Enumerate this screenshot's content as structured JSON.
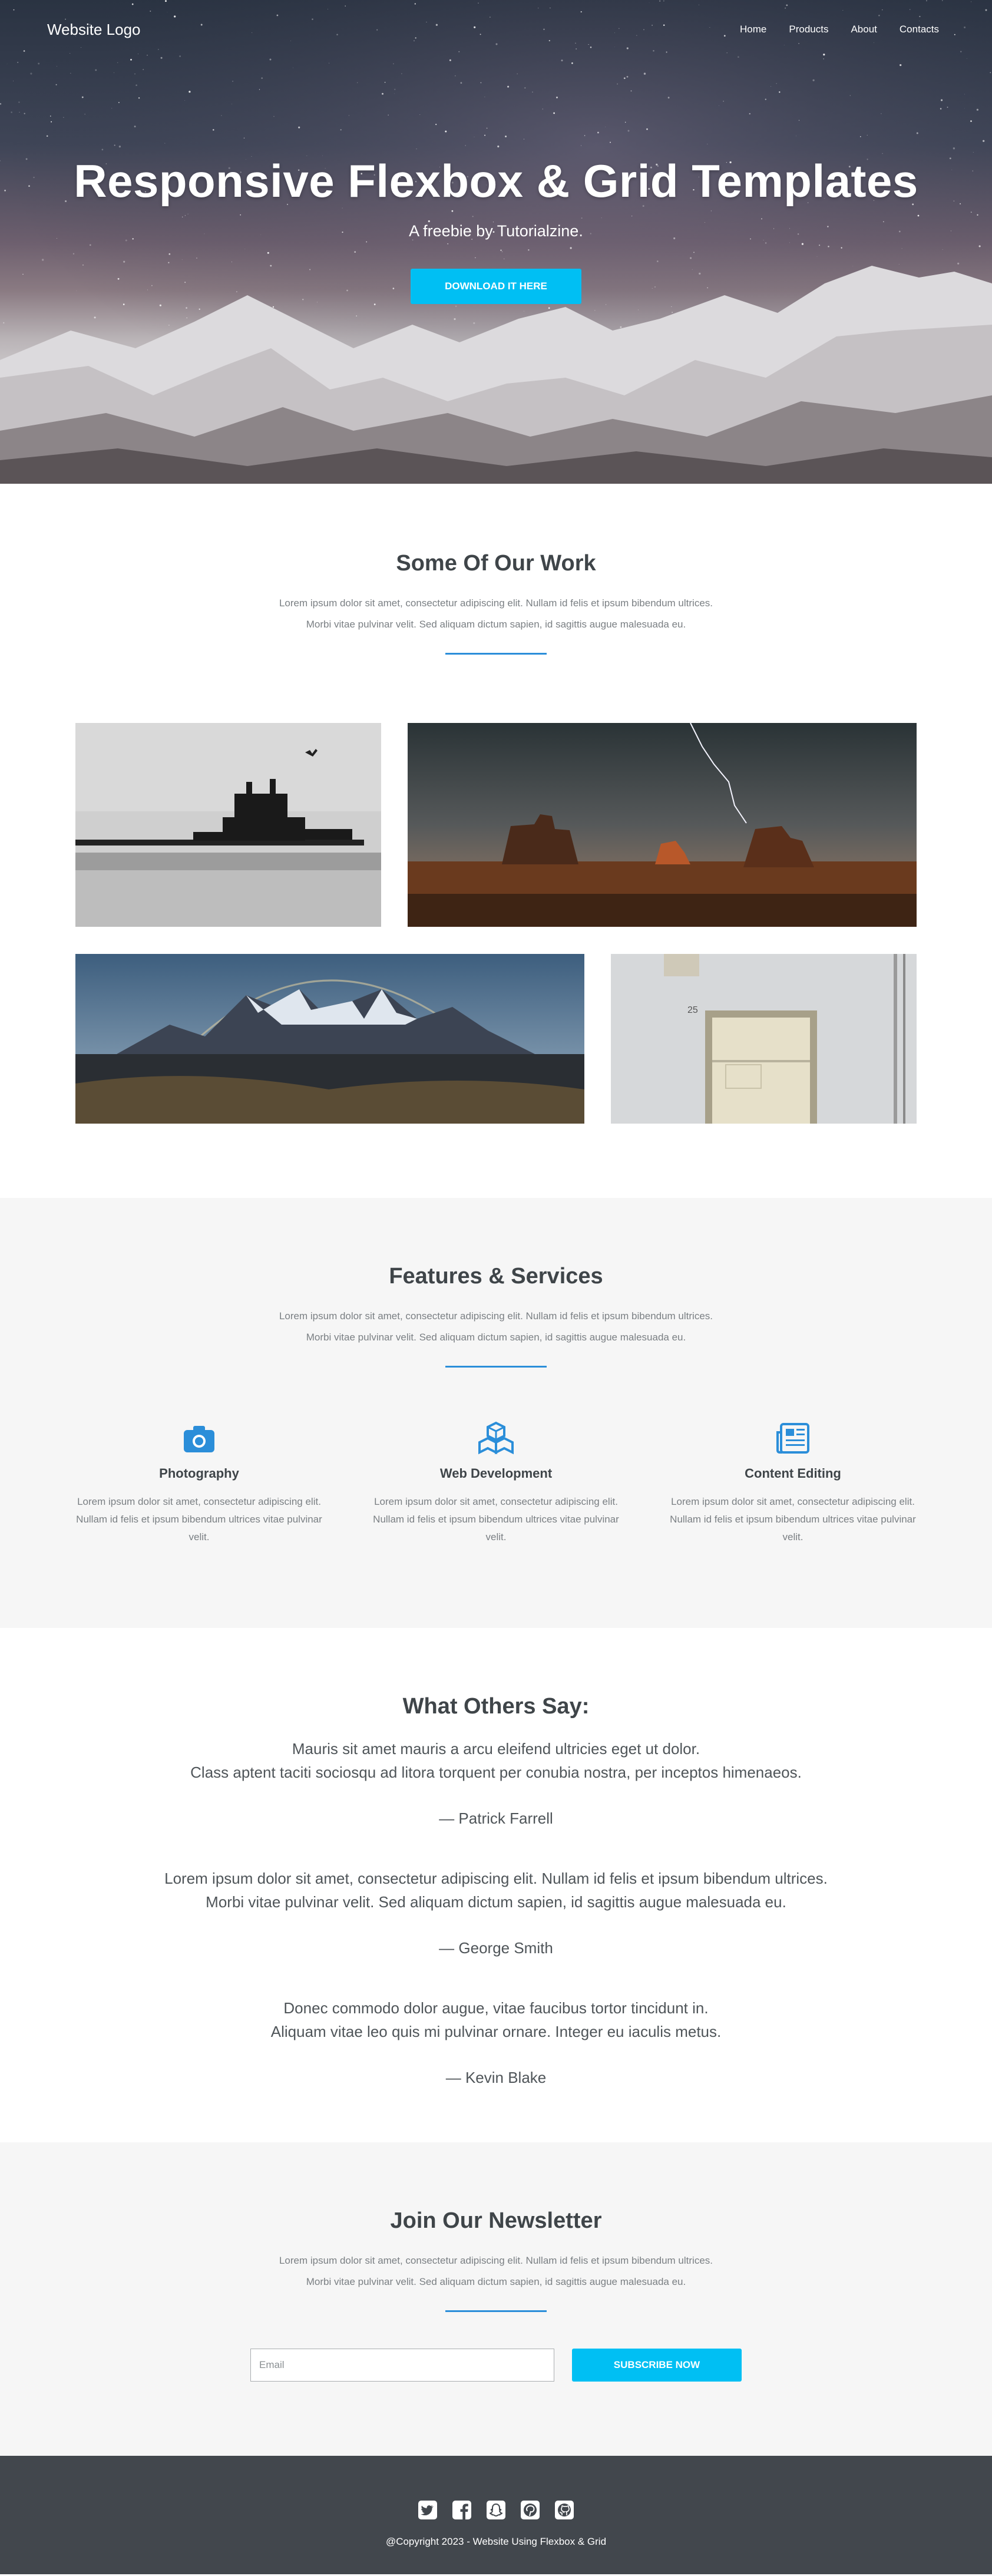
{
  "nav": {
    "logo": "Website Logo",
    "items": [
      "Home",
      "Products",
      "About",
      "Contacts"
    ]
  },
  "hero": {
    "title": "Responsive Flexbox & Grid Templates",
    "subtitle": "A freebie by Tutorialzine.",
    "button": "DOWNLOAD IT HERE"
  },
  "work": {
    "title": "Some Of Our Work",
    "desc_line1": "Lorem ipsum dolor sit amet, consectetur adipiscing elit. Nullam id felis et ipsum bibendum ultrices.",
    "desc_line2": "Morbi vitae pulvinar velit. Sed aliquam dictum sapien, id sagittis augue malesuada eu.",
    "images": [
      "pier-photo",
      "desert-storm-photo",
      "mountain-rainbow-photo",
      "door-photo"
    ]
  },
  "features": {
    "title": "Features & Services",
    "desc_line1": "Lorem ipsum dolor sit amet, consectetur adipiscing elit. Nullam id felis et ipsum bibendum ultrices.",
    "desc_line2": "Morbi vitae pulvinar velit. Sed aliquam dictum sapien, id sagittis augue malesuada eu.",
    "items": [
      {
        "icon": "camera-icon",
        "title": "Photography",
        "text": "Lorem ipsum dolor sit amet, consectetur adipiscing elit. Nullam id felis et ipsum bibendum ultrices vitae pulvinar velit."
      },
      {
        "icon": "cubes-icon",
        "title": "Web Development",
        "text": "Lorem ipsum dolor sit amet, consectetur adipiscing elit. Nullam id felis et ipsum bibendum ultrices vitae pulvinar velit."
      },
      {
        "icon": "newspaper-icon",
        "title": "Content Editing",
        "text": "Lorem ipsum dolor sit amet, consectetur adipiscing elit. Nullam id felis et ipsum bibendum ultrices vitae pulvinar velit."
      }
    ],
    "accent": "#2b8ed9"
  },
  "testimonials": {
    "title": "What Others Say:",
    "quotes": [
      {
        "line1": "Mauris sit amet mauris a arcu eleifend ultricies eget ut dolor.",
        "line2": "Class aptent taciti sociosqu ad litora torquent per conubia nostra, per inceptos himenaeos.",
        "author": "— Patrick Farrell"
      },
      {
        "line1": "Lorem ipsum dolor sit amet, consectetur adipiscing elit. Nullam id felis et ipsum bibendum ultrices.",
        "line2": "Morbi vitae pulvinar velit. Sed aliquam dictum sapien, id sagittis augue malesuada eu.",
        "author": "— George Smith"
      },
      {
        "line1": "Donec commodo dolor augue, vitae faucibus tortor tincidunt in.",
        "line2": "Aliquam vitae leo quis mi pulvinar ornare. Integer eu iaculis metus.",
        "author": "— Kevin Blake"
      }
    ]
  },
  "newsletter": {
    "title": "Join Our Newsletter",
    "desc_line1": "Lorem ipsum dolor sit amet, consectetur adipiscing elit. Nullam id felis et ipsum bibendum ultrices.",
    "desc_line2": "Morbi vitae pulvinar velit. Sed aliquam dictum sapien, id sagittis augue malesuada eu.",
    "placeholder": "Email",
    "button": "SUBSCRIBE NOW"
  },
  "footer": {
    "social": [
      "twitter-icon",
      "facebook-icon",
      "snapchat-icon",
      "pinterest-icon",
      "github-icon"
    ],
    "copyright": "@Copyright 2023 - Website Using Flexbox & Grid"
  },
  "colors": {
    "accent_button": "#00bff3",
    "footer_bg": "#42474d",
    "section_bg": "#f6f6f6"
  }
}
